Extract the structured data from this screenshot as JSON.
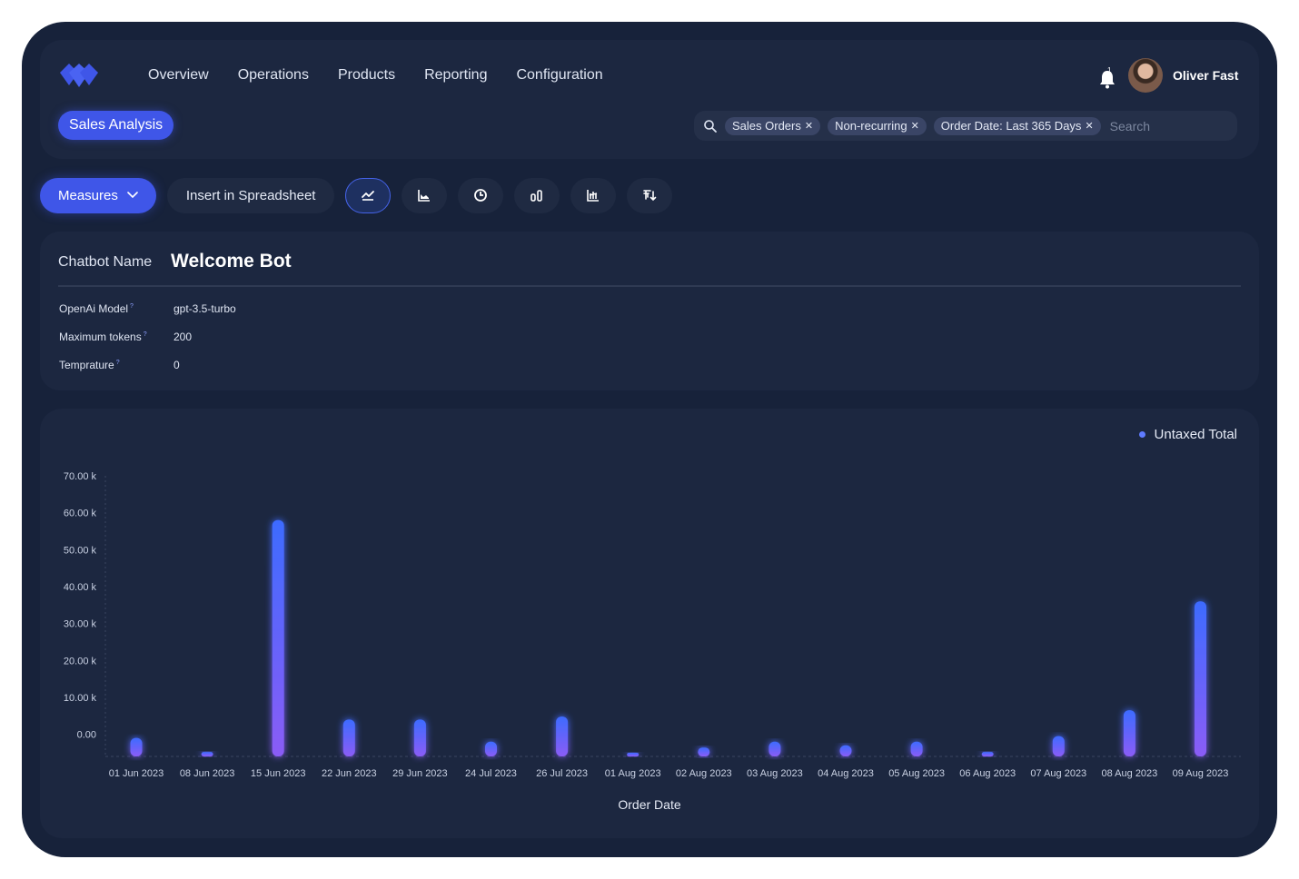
{
  "nav": {
    "items": [
      "Overview",
      "Operations",
      "Products",
      "Reporting",
      "Configuration"
    ]
  },
  "user": {
    "name": "Oliver Fast",
    "notifications": "1"
  },
  "page_tab": "Sales Analysis",
  "search": {
    "chips": [
      "Sales Orders",
      "Non-recurring",
      "Order Date: Last 365 Days"
    ],
    "placeholder": "Search"
  },
  "toolbar": {
    "measures_label": "Measures",
    "spreadsheet_label": "Insert in Spreadsheet",
    "view_icons": [
      "line-chart-icon",
      "area-chart-icon",
      "pie-chart-icon",
      "bar-chart-icon",
      "stacked-chart-icon",
      "sort-icon"
    ]
  },
  "bot": {
    "name_label": "Chatbot Name",
    "name_value": "Welcome Bot",
    "fields": [
      {
        "label": "OpenAi Model",
        "value": "gpt-3.5-turbo"
      },
      {
        "label": "Maximum tokens",
        "value": "200"
      },
      {
        "label": "Temprature",
        "value": "0"
      }
    ]
  },
  "colors": {
    "accent": "#3f56e8",
    "bar_top": "#3d6bff",
    "bar_bottom": "#8b5cf6"
  },
  "chart_data": {
    "type": "bar",
    "title": "",
    "xlabel": "Order Date",
    "ylabel": "",
    "legend": {
      "entries": [
        "Untaxed Total"
      ],
      "placement": "top-right"
    },
    "y_ticks": [
      "0.00",
      "10.00 k",
      "20.00 k",
      "30.00 k",
      "40.00 k",
      "50.00 k",
      "60.00 k",
      "70.00 k"
    ],
    "ylim": [
      -6000,
      70000
    ],
    "categories": [
      "01 Jun 2023",
      "08 Jun 2023",
      "15 Jun 2023",
      "22 Jun 2023",
      "29 Jun 2023",
      "24 Jul 2023",
      "26 Jul 2023",
      "01 Aug 2023",
      "02 Aug 2023",
      "03 Aug 2023",
      "04 Aug 2023",
      "05 Aug 2023",
      "06 Aug 2023",
      "07 Aug 2023",
      "08 Aug 2023",
      "09 Aug 2023"
    ],
    "series": [
      {
        "name": "Untaxed Total",
        "values": [
          -1000,
          -4800,
          58000,
          4000,
          4000,
          -2000,
          4800,
          -5600,
          -3600,
          -2000,
          -3000,
          -2000,
          -4800,
          -500,
          6500,
          36000
        ]
      }
    ]
  }
}
